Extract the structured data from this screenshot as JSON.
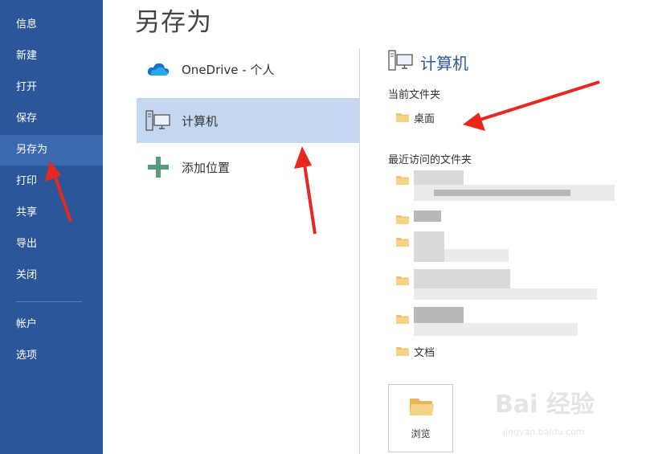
{
  "sidebar": {
    "items": [
      {
        "label": "信息"
      },
      {
        "label": "新建"
      },
      {
        "label": "打开"
      },
      {
        "label": "保存"
      },
      {
        "label": "另存为"
      },
      {
        "label": "打印"
      },
      {
        "label": "共享"
      },
      {
        "label": "导出"
      },
      {
        "label": "关闭"
      },
      {
        "label": "帐户"
      },
      {
        "label": "选项"
      }
    ],
    "active": "另存为",
    "color": "#2b579a"
  },
  "page": {
    "title": "另存为"
  },
  "locations": [
    {
      "label": "OneDrive - 个人",
      "icon": "cloud-icon"
    },
    {
      "label": "计算机",
      "icon": "computer-icon",
      "selected": true
    },
    {
      "label": "添加位置",
      "icon": "plus-icon"
    }
  ],
  "right_panel": {
    "title": "计算机",
    "current_folder_label": "当前文件夹",
    "current_folder": "桌面",
    "recent_label": "最近访问的文件夹",
    "recent_last": "文档",
    "browse_label": "浏览"
  },
  "watermark": {
    "main": "Bai 经验",
    "sub": "jingyan.baidu.com"
  },
  "colors": {
    "accent": "#2b579a",
    "selected": "#c5d7f0",
    "arrow": "#e8281e",
    "folder": "#f0c46c"
  }
}
